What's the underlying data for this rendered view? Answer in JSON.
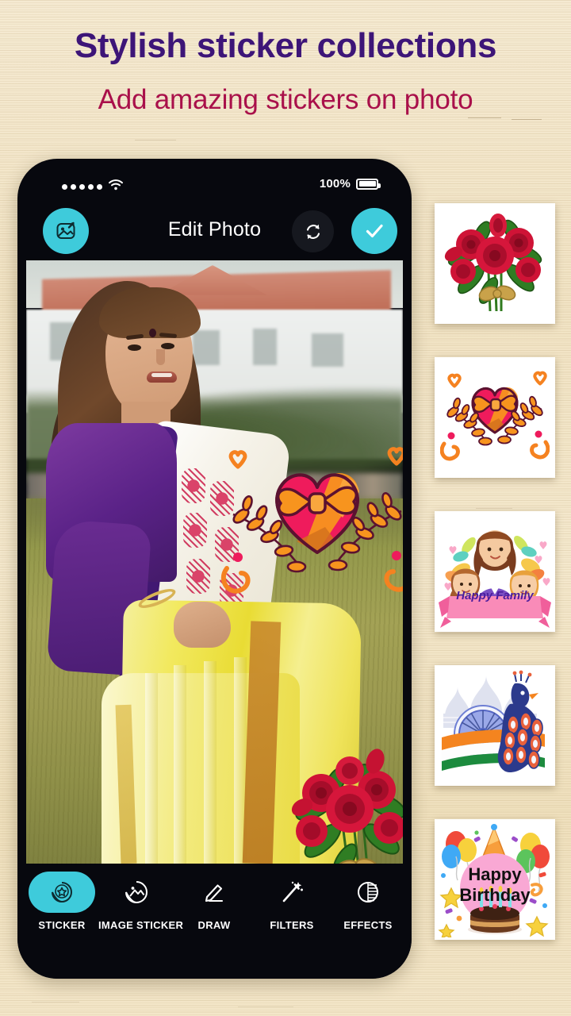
{
  "header": {
    "title": "Stylish sticker collections",
    "subtitle": "Add amazing stickers on photo",
    "title_color": "#3d1578",
    "subtitle_color": "#a9104a"
  },
  "theme": {
    "accent": "#3ecbdb",
    "phone_body": "#07080e",
    "background": "#f2e5c8"
  },
  "phone": {
    "status_bar": {
      "signal_icon": "signal-dots-icon",
      "signal_bars": 5,
      "wifi_icon": "wifi-icon",
      "battery_percent": "100%",
      "battery_icon": "battery-full-icon"
    },
    "navbar": {
      "gallery_icon": "image-edit-icon",
      "title": "Edit Photo",
      "reset_icon": "refresh-icon",
      "done_icon": "check-icon"
    },
    "toolbar": {
      "items": [
        {
          "label": "STICKER",
          "icon": "sticker-star-icon",
          "active": true
        },
        {
          "label": "IMAGE STICKER",
          "icon": "image-sticker-icon",
          "active": false
        },
        {
          "label": "DRAW",
          "icon": "pencil-icon",
          "active": false
        },
        {
          "label": "FILTERS",
          "icon": "magic-wand-icon",
          "active": false
        },
        {
          "label": "EFFECTS",
          "icon": "contrast-circle-icon",
          "active": false
        }
      ]
    },
    "canvas": {
      "photo_description": "Woman in yellow and purple saree standing on grass in front of white building",
      "applied_stickers": [
        {
          "name": "heart-gift-wreath-sticker",
          "position": "center"
        },
        {
          "name": "red-rose-bouquet-sticker",
          "position": "bottom-right"
        }
      ]
    }
  },
  "sticker_rail": {
    "items": [
      {
        "name": "red-rose-bouquet-sticker",
        "caption": ""
      },
      {
        "name": "heart-gift-wreath-sticker",
        "caption": ""
      },
      {
        "name": "happy-family-sticker",
        "caption": "Happy Family"
      },
      {
        "name": "india-peacock-sticker",
        "caption": ""
      },
      {
        "name": "happy-birthday-sticker",
        "caption_line1": "Happy",
        "caption_line2": "Birthday"
      }
    ]
  }
}
